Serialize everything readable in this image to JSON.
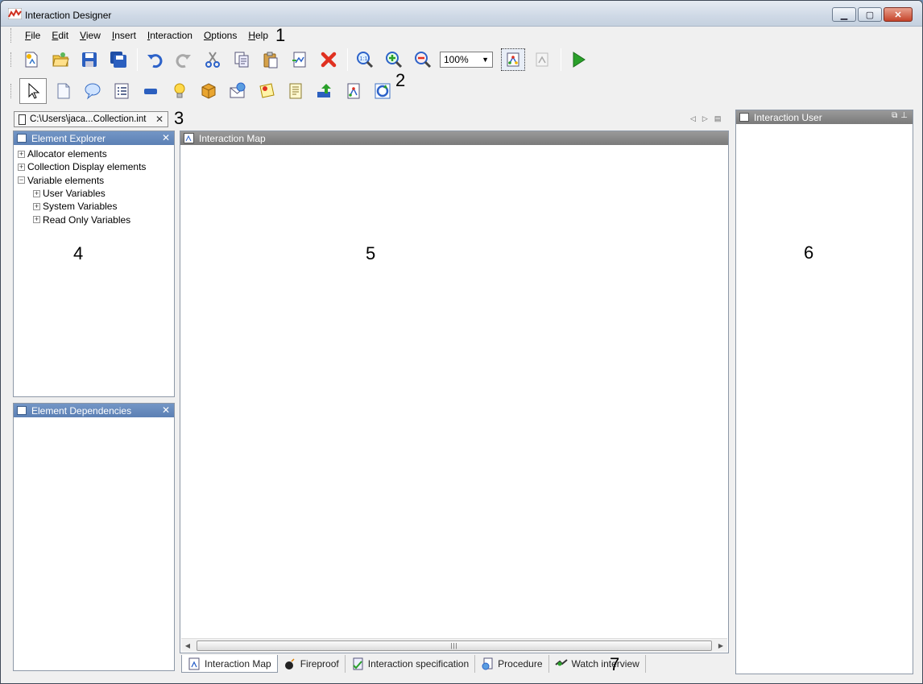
{
  "window": {
    "title": "Interaction Designer",
    "controls": [
      "minimize",
      "restore",
      "close"
    ]
  },
  "menu": [
    {
      "label": "File",
      "hotkey": "F",
      "rest": "ile"
    },
    {
      "label": "Edit",
      "hotkey": "E",
      "rest": "dit"
    },
    {
      "label": "View",
      "hotkey": "V",
      "rest": "iew"
    },
    {
      "label": "Insert",
      "hotkey": "I",
      "rest": "nsert"
    },
    {
      "label": "Interaction",
      "hotkey": "I",
      "rest": "nteraction"
    },
    {
      "label": "Options",
      "hotkey": "O",
      "rest": "ptions"
    },
    {
      "label": "Help",
      "hotkey": "H",
      "rest": "elp"
    }
  ],
  "toolbar": {
    "zoom_value": "100%",
    "buttons": [
      "new-icon",
      "open-icon",
      "save-icon",
      "save-all-icon",
      "undo-icon",
      "redo-icon",
      "cut-icon",
      "copy-icon",
      "paste-icon",
      "paste-special-icon",
      "delete-icon",
      "zoom-actual-icon",
      "zoom-in-icon",
      "zoom-out-icon",
      "show-map-icon",
      "map-disabled-icon",
      "run-icon"
    ]
  },
  "palette": [
    "pointer-icon",
    "document-icon",
    "speech-bubble-icon",
    "list-icon",
    "button-element-icon",
    "lightbulb-icon",
    "package-icon",
    "email-icon",
    "note-icon",
    "text-element-icon",
    "upload-icon",
    "interaction-map-icon",
    "refresh-cycle-icon"
  ],
  "document_tab": {
    "label": "C:\\Users\\jaca...Collection.int"
  },
  "element_explorer": {
    "title": "Element Explorer",
    "items": [
      {
        "label": "Allocator elements",
        "expander": "+",
        "level": 1
      },
      {
        "label": "Collection Display elements",
        "expander": "+",
        "level": 1
      },
      {
        "label": "Variable elements",
        "expander": "−",
        "level": 1
      },
      {
        "label": "User Variables",
        "expander": "+",
        "level": 2
      },
      {
        "label": "System Variables",
        "expander": "+",
        "level": 2
      },
      {
        "label": "Read Only Variables",
        "expander": "+",
        "level": 2
      }
    ]
  },
  "element_dependencies": {
    "title": "Element Dependencies"
  },
  "interaction_map": {
    "title": "Interaction Map"
  },
  "interaction_user": {
    "title": "Interaction User"
  },
  "bottom_tabs": [
    {
      "label": "Interaction Map"
    },
    {
      "label": "Fireproof"
    },
    {
      "label": "Interaction specification"
    },
    {
      "label": "Procedure"
    },
    {
      "label": "Watch interview"
    }
  ],
  "callouts": [
    "1",
    "2",
    "3",
    "4",
    "5",
    "6",
    "7"
  ],
  "colors": {
    "panel_header_blue": "#5c80b4",
    "panel_header_gray": "#7a7a7a",
    "delete_red": "#e03020",
    "run_green": "#2aa02a"
  }
}
